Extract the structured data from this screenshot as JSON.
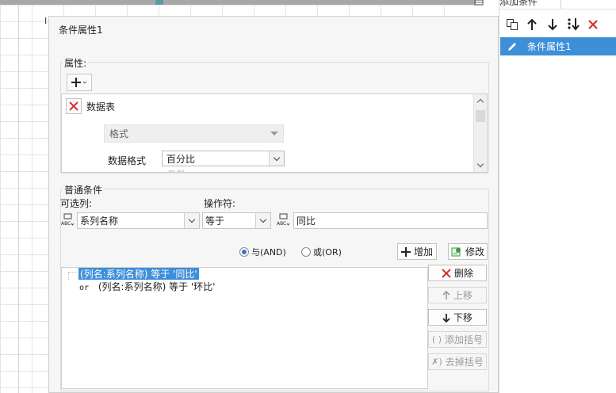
{
  "sheet": {
    "cell_mark": "I"
  },
  "right_panel": {
    "title": "添加条件",
    "toolbar": [
      "copy-icon",
      "arrow-up-icon",
      "arrow-down-icon",
      "move-bottom-icon",
      "delete-x-icon"
    ],
    "items": [
      {
        "label": "条件属性1",
        "selected": true
      }
    ]
  },
  "dialog": {
    "title": "条件属性1",
    "attributes": {
      "legend": "属性:",
      "add_icon": "plus-icon",
      "property": {
        "name": "数据表",
        "format_placeholder": "格式",
        "data_format_label": "数据格式",
        "data_format_value": "百分比",
        "cutoff_text": "示例"
      }
    },
    "condition": {
      "legend": "普通条件",
      "column_label": "可选列:",
      "column_value": "系列名称",
      "operator_label": "操作符:",
      "operator_value": "等于",
      "value": "同比",
      "radio_and": "与(AND)",
      "radio_or": "或(OR)",
      "radio_selected": "and",
      "add_button": "增加",
      "modify_button": "修改"
    },
    "condition_list": {
      "items": [
        {
          "prefix": "",
          "text": "(列名:系列名称) 等于 '同比'",
          "selected": true
        },
        {
          "prefix": "or",
          "text": "(列名:系列名称) 等于 '环比'",
          "selected": false
        }
      ]
    },
    "side_buttons": {
      "delete": "删除",
      "move_up": "上移",
      "move_down": "下移",
      "add_bracket": "添加括号",
      "remove_bracket": "去掉括号"
    },
    "colors": {
      "selection": "#3d8fd8",
      "delete_red": "#d9312b",
      "modify_green": "#3e9b3e"
    }
  }
}
